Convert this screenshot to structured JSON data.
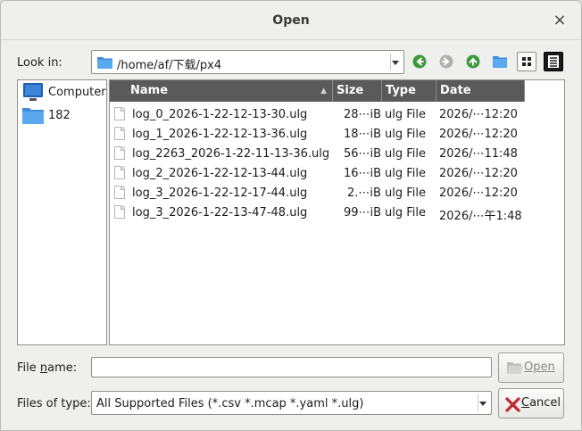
{
  "window": {
    "title": "Open"
  },
  "look_in": {
    "label": "Look in:",
    "path": "/home/af/下载/px4"
  },
  "toolbar": {
    "icons": [
      "back-icon",
      "forward-icon",
      "parent-directory-icon",
      "new-folder-icon",
      "list-view-icon",
      "detail-view-icon"
    ],
    "accent": "#3c9a3c"
  },
  "sidebar": {
    "items": [
      {
        "label": "Computer",
        "icon": "computer-icon"
      },
      {
        "label": "182",
        "icon": "folder-icon"
      }
    ]
  },
  "file_list": {
    "columns": [
      "Name",
      "Size",
      "Type",
      "Date Modified"
    ],
    "rows": [
      {
        "name": "log_0_2026-1-22-12-13-30.ulg",
        "size": "28⋯iB",
        "type": "ulg File",
        "date": "2026/⋯12:20"
      },
      {
        "name": "log_1_2026-1-22-12-13-36.ulg",
        "size": "18⋯iB",
        "type": "ulg File",
        "date": "2026/⋯12:20"
      },
      {
        "name": "log_2263_2026-1-22-11-13-36.ulg",
        "size": "56⋯iB",
        "type": "ulg File",
        "date": "2026/⋯11:48"
      },
      {
        "name": "log_2_2026-1-22-12-13-44.ulg",
        "size": "16⋯iB",
        "type": "ulg File",
        "date": "2026/⋯12:20"
      },
      {
        "name": "log_3_2026-1-22-12-17-44.ulg",
        "size": "2.⋯iB",
        "type": "ulg File",
        "date": "2026/⋯12:20"
      },
      {
        "name": "log_3_2026-1-22-13-47-48.ulg",
        "size": "99⋯iB",
        "type": "ulg File",
        "date": "2026/⋯午1:48"
      }
    ]
  },
  "file_name": {
    "label": "File name:",
    "value": ""
  },
  "file_type": {
    "label": "Files of type:",
    "value": "All Supported Files (*.csv *.mcap *.yaml *.ulg)"
  },
  "buttons": {
    "open": "Open",
    "cancel": "Cancel"
  }
}
